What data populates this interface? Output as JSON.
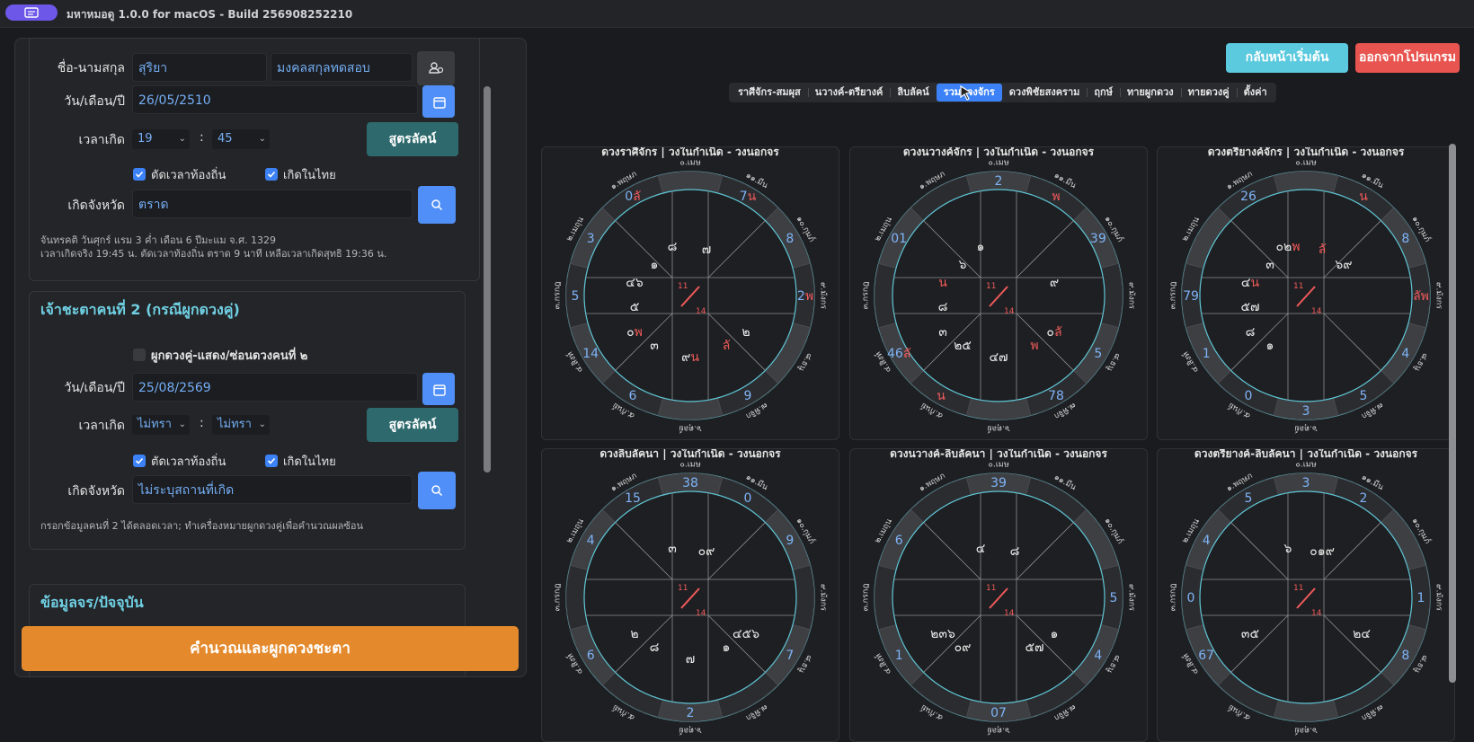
{
  "window": {
    "title": "มหาหมอดู 1.0.0 for macOS - Build 256908252210"
  },
  "person1": {
    "name_label": "ชื่อ-นามสกุล",
    "first_name": "สุริยา",
    "last_name": "มงคลสกุลทดสอบ",
    "date_label": "วัน/เดือน/ปี",
    "date": "26/05/2510",
    "time_label": "เวลาเกิด",
    "hour": "19",
    "minute": "45",
    "lagna_button": "สูตรลัคน์",
    "local_time_check": "ตัดเวลาท้องถิ่น",
    "born_thai_check": "เกิดในไทย",
    "province_label": "เกิดจังหวัด",
    "province": "ตราด",
    "note_line1": "จันทรคติ วันศุกร์ แรม 3 ค่ำ เดือน 6 ปีมะแม จ.ศ. 1329",
    "note_line2": "เวลาเกิดจริง 19:45 น. ตัดเวลาท้องถิ่น ตราด 9 นาที เหลือเวลาเกิดสุทธิ 19:36 น."
  },
  "person2": {
    "section_title": "เจ้าชะตาคนที่ 2 (กรณีผูกดวงคู่)",
    "pair_check": "ผูกดวงคู่-แสดง/ซ่อนดวงคนที่ ๒",
    "date_label": "วัน/เดือน/ปี",
    "date": "25/08/2569",
    "time_label": "เวลาเกิด",
    "hour": "ไม่ทรา",
    "minute": "ไม่ทรา",
    "lagna_button": "สูตรลัคน์",
    "local_time_check": "ตัดเวลาท้องถิ่น",
    "born_thai_check": "เกิดในไทย",
    "province_label": "เกิดจังหวัด",
    "province": "ไม่ระบุสถานที่เกิด",
    "note": "กรอกข้อมูลคนที่ 2 ได้ตลอดเวลา; ทำเครื่องหมายผูกดวงคู่เพื่อคำนวณผลซ้อน"
  },
  "current": {
    "section_title": "ข้อมูลจร/ปัจจุบัน"
  },
  "calc_button": "คำนวณและผูกดวงชะตา",
  "home_button": "กลับหน้าเริ่มต้น",
  "exit_button": "ออกจากโปรแกรม",
  "tabs": [
    "ราศีจักร-สมผุส",
    "นวางค์-ตรียางค์",
    "ลิบลัคน์",
    "รวมดวงจักร",
    "ดวงพิชัยสงคราม",
    "ฤกษ์",
    "ทายผูกดวง",
    "ทายดวงคู่",
    "ตั้งค่า"
  ],
  "active_tab": 3,
  "colors": {
    "accent": "#3c82f6",
    "teal": "#2e6a6d",
    "orange": "#e48a2c",
    "cyan": "#6fd0e3",
    "red": "#e8544f",
    "planet_blue": "#7eb4f7",
    "planet_red": "#f05a5a"
  },
  "signs": [
    "๑.พฤษภ",
    "๐.เมษ",
    "๑๑.มีน",
    "๑๐.กุมภ์",
    "๙.มังกร",
    "๘.ธนู",
    "๗.พิจิก",
    "๖.ตุลย์",
    "๕.กันย์",
    "๔.สิงห์",
    "๓.กรกฎ",
    "๒.เมถุน"
  ],
  "center_top": "11",
  "center_bottom": "14",
  "charts": [
    {
      "title": "ดวงราศีจักร | วงในกำเนิด - วงนอกจร",
      "outer": [
        [
          "0",
          "hn",
          "ลั",
          "hr"
        ],
        [
          "",
          ""
        ],
        [
          "7",
          "hn",
          "น",
          "hr"
        ],
        [
          "8",
          "hn"
        ],
        [
          "2",
          "hn",
          "พ",
          "hr"
        ],
        [
          "",
          ""
        ],
        [
          "9",
          "hn"
        ],
        [
          "",
          ""
        ],
        [
          "6",
          "hn"
        ],
        [
          "14",
          "hn"
        ],
        [
          "5",
          "hn"
        ],
        [
          "3",
          "hn"
        ]
      ],
      "inner": [
        [
          "๑",
          "hw"
        ],
        [
          "๘",
          "hw"
        ],
        [
          "๗",
          "hw"
        ],
        [
          "",
          ""
        ],
        [
          "",
          ""
        ],
        [
          "๒",
          "hw"
        ],
        [
          "ลั",
          "hr"
        ],
        [
          "๙",
          "hw",
          "น",
          "hr"
        ],
        [
          "๓",
          "hw"
        ],
        [
          "๐",
          "hw",
          "พ",
          "hr"
        ],
        [
          "๕",
          "hw"
        ],
        [
          "๔๖",
          "hw"
        ]
      ]
    },
    {
      "title": "ดวงนวางค์จักร | วงในกำเนิด - วงนอกจร",
      "outer": [
        [
          "",
          ""
        ],
        [
          "2",
          "hn"
        ],
        [
          "พ",
          "hr"
        ],
        [
          "39",
          "hn"
        ],
        [
          "",
          ""
        ],
        [
          "5",
          "hn"
        ],
        [
          "78",
          "hn"
        ],
        [
          "",
          ""
        ],
        [
          "น",
          "hr"
        ],
        [
          "46",
          "hn",
          "ลั",
          "hr"
        ],
        [
          "",
          ""
        ],
        [
          "01",
          "hn"
        ]
      ],
      "inner": [
        [
          "๖",
          "hw"
        ],
        [
          "๑",
          "hw"
        ],
        [
          "",
          ""
        ],
        [
          "",
          ""
        ],
        [
          "๙",
          "hw"
        ],
        [
          "๐",
          "hw",
          "ลั",
          "hr"
        ],
        [
          "พ",
          "hr"
        ],
        [
          "๔๗",
          "hw"
        ],
        [
          "๒๕",
          "hw"
        ],
        [
          "๓",
          "hw"
        ],
        [
          "๘",
          "hw"
        ],
        [
          "น",
          "hr"
        ]
      ]
    },
    {
      "title": "ดวงตรียางค์จักร | วงในกำเนิด - วงนอกจร",
      "outer": [
        [
          "26",
          "hn"
        ],
        [
          "",
          ""
        ],
        [
          "น",
          "hr"
        ],
        [
          "8",
          "hn"
        ],
        [
          "ลัพ",
          "hr"
        ],
        [
          "4",
          "hn"
        ],
        [
          "5",
          "hn"
        ],
        [
          "3",
          "hn"
        ],
        [
          "0",
          "hn"
        ],
        [
          "1",
          "hn"
        ],
        [
          "79",
          "hn"
        ],
        [
          "",
          ""
        ]
      ],
      "inner": [
        [
          "๓",
          "hw"
        ],
        [
          "๐๒",
          "hw",
          "พ",
          "hr"
        ],
        [
          "ลั",
          "hr"
        ],
        [
          "๖๙",
          "hw"
        ],
        [
          "",
          ""
        ],
        [
          "",
          ""
        ],
        [
          "",
          ""
        ],
        [
          "",
          ""
        ],
        [
          "๑",
          "hw"
        ],
        [
          "๘",
          "hw"
        ],
        [
          "๕๗",
          "hw"
        ],
        [
          "๔",
          "hw",
          "น",
          "hr"
        ]
      ]
    },
    {
      "title": "ดวงลิบลัคนา | วงในกำเนิด - วงนอกจร",
      "outer": [
        [
          "15",
          "hn"
        ],
        [
          "38",
          "hn"
        ],
        [
          "0",
          "hn"
        ],
        [
          "9",
          "hn"
        ],
        [
          "",
          ""
        ],
        [
          "7",
          "hn"
        ],
        [
          "",
          ""
        ],
        [
          "2",
          "hn"
        ],
        [
          "",
          ""
        ],
        [
          "6",
          "hn"
        ],
        [
          "",
          ""
        ],
        [
          "4",
          "hn"
        ]
      ],
      "inner": [
        [
          "",
          ""
        ],
        [
          "๓",
          "hw"
        ],
        [
          "๐๙",
          "hw"
        ],
        [
          "",
          ""
        ],
        [
          "",
          ""
        ],
        [
          "๔๕๖",
          "hw"
        ],
        [
          "๑",
          "hw"
        ],
        [
          "๗",
          "hw"
        ],
        [
          "๘",
          "hw"
        ],
        [
          "๒",
          "hw"
        ],
        [
          "",
          ""
        ],
        [
          "",
          ""
        ]
      ]
    },
    {
      "title": "ดวงนวางค์-ลิบลัคนา | วงในกำเนิด - วงนอกจร",
      "outer": [
        [
          "",
          ""
        ],
        [
          "39",
          "hn"
        ],
        [
          "",
          ""
        ],
        [
          "",
          ""
        ],
        [
          "5",
          "hn"
        ],
        [
          "4",
          "hn"
        ],
        [
          "",
          ""
        ],
        [
          "07",
          "hn"
        ],
        [
          "",
          ""
        ],
        [
          "1",
          "hn"
        ],
        [
          "",
          ""
        ],
        [
          "6",
          "hn"
        ]
      ],
      "inner": [
        [
          "",
          ""
        ],
        [
          "๔",
          "hw"
        ],
        [
          "๘",
          "hw"
        ],
        [
          "",
          ""
        ],
        [
          "",
          ""
        ],
        [
          "๑",
          "hw"
        ],
        [
          "๕๗",
          "hw"
        ],
        [
          "",
          ""
        ],
        [
          "๐๙",
          "hw"
        ],
        [
          "๒๓๖",
          "hw"
        ],
        [
          "",
          ""
        ],
        [
          "",
          ""
        ]
      ]
    },
    {
      "title": "ดวงตรียางค์-ลิบลัคนา | วงในกำเนิด - วงนอกจร",
      "outer": [
        [
          "5",
          "hn"
        ],
        [
          "3",
          "hn"
        ],
        [
          "2",
          "hn"
        ],
        [
          "",
          ""
        ],
        [
          "1",
          "hn"
        ],
        [
          "8",
          "hn"
        ],
        [
          "",
          ""
        ],
        [
          "",
          ""
        ],
        [
          "",
          ""
        ],
        [
          "67",
          "hn"
        ],
        [
          "0",
          "hn"
        ],
        [
          "4",
          "hn"
        ]
      ],
      "inner": [
        [
          "",
          ""
        ],
        [
          "๖",
          "hw"
        ],
        [
          "๐๑๙",
          "hw"
        ],
        [
          "",
          ""
        ],
        [
          "",
          ""
        ],
        [
          "๒๔",
          "hw"
        ],
        [
          "",
          ""
        ],
        [
          "",
          ""
        ],
        [
          "",
          ""
        ],
        [
          "๓๕",
          "hw"
        ],
        [
          "",
          ""
        ],
        [
          "",
          ""
        ]
      ]
    }
  ]
}
